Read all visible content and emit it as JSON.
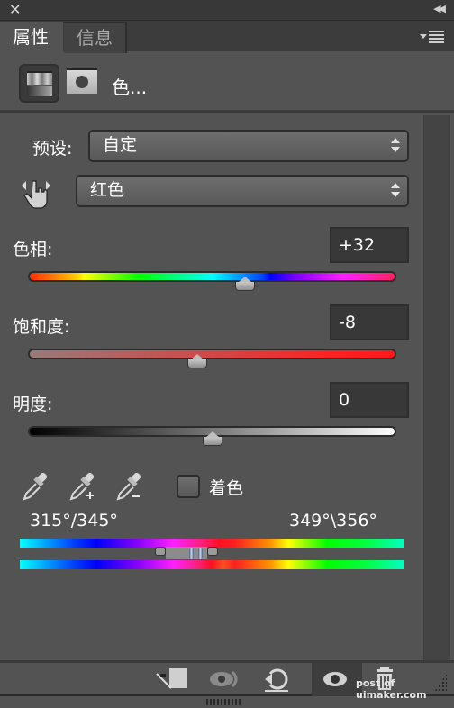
{
  "panel": {
    "close_icon": "✕",
    "collapse_icon": "◀◀",
    "tabs": [
      {
        "label": "属性",
        "active": true
      },
      {
        "label": "信息",
        "active": false
      }
    ],
    "menu_icon": "panel-menu-icon"
  },
  "header": {
    "adjustment_icon": "hue-saturation-icon",
    "mask_icon": "layer-mask-icon",
    "title": "色..."
  },
  "preset": {
    "label": "预设:",
    "value": "自定"
  },
  "channel": {
    "target_tool_icon": "on-image-adjust-hand-icon",
    "value": "红色"
  },
  "hue": {
    "label": "色相:",
    "value": "+32",
    "min": -180,
    "max": 180,
    "current": 32
  },
  "saturation": {
    "label": "饱和度:",
    "value": "-8",
    "min": -100,
    "max": 100,
    "current": -8
  },
  "lightness": {
    "label": "明度:",
    "value": "0",
    "min": -100,
    "max": 100,
    "current": 0
  },
  "tools": {
    "eyedropper": "eyedropper-icon",
    "eyedropper_add": "eyedropper-plus-icon",
    "eyedropper_subtract": "eyedropper-minus-icon",
    "colorize_label": "着色",
    "colorize_checked": false
  },
  "range": {
    "left_text": "315°/345°",
    "right_text": "349°\\356°"
  },
  "bottom_toolbar": {
    "clip_to_layer": "clip-to-layer-icon",
    "view_previous": "view-previous-state-icon",
    "reset": "reset-icon",
    "toggle_visibility": "visibility-eye-icon",
    "delete": "trash-icon"
  },
  "watermark": "post of uimaker.com"
}
